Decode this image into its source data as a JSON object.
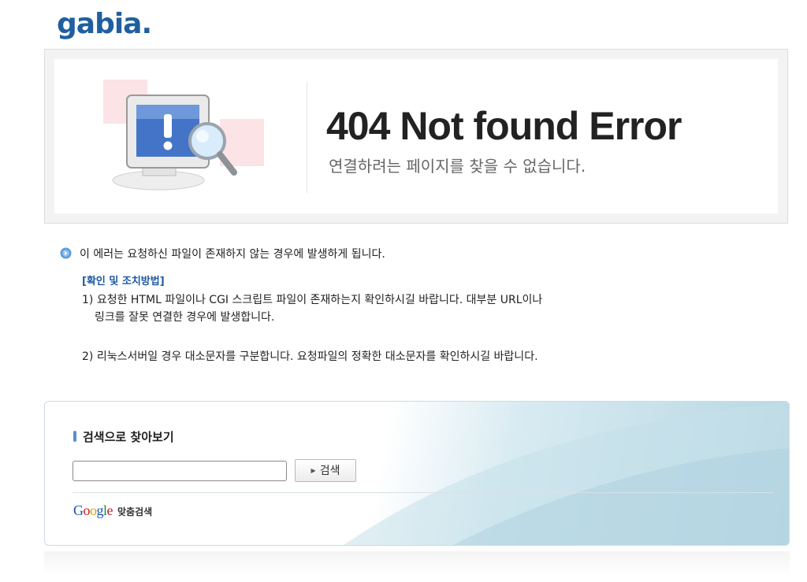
{
  "brand": {
    "logo_text": "gabia",
    "logo_dot": "."
  },
  "error": {
    "title": "404 Not found Error",
    "subtitle": "연결하려는 페이지를 찾을 수 없습니다."
  },
  "info": {
    "message": "이 에러는 요청하신 파일이 존재하지 않는 경우에 발생하게 됩니다.",
    "help_heading": "[확인 및 조치방법]",
    "step1_line1": "1) 요청한 HTML 파일이나 CGI 스크립트 파일이 존재하는지 확인하시길 바랍니다. 대부분 URL이나",
    "step1_line2": "링크를 잘못 연결한 경우에 발생합니다.",
    "step2": "2) 리눅스서버일 경우 대소문자를 구분합니다. 요청파일의 정확한 대소문자를 확인하시길 바랍니다."
  },
  "search": {
    "title": "검색으로 찾아보기",
    "input_value": "",
    "button_label": "검색",
    "google_label": "맞춤검색",
    "google_logo": {
      "g1": "G",
      "o1": "o",
      "o2": "o",
      "g2": "g",
      "l": "l",
      "e": "e"
    }
  },
  "colors": {
    "brand": "#1f5fa0",
    "heading_link": "#1d59a6",
    "panel_accent": "#b6d6e2"
  }
}
